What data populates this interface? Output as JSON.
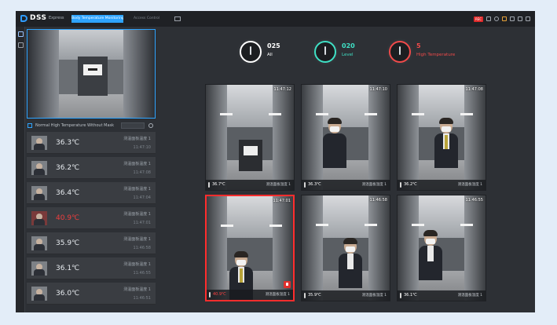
{
  "titlebar": {
    "app_name": "DSS",
    "app_sub": "Express",
    "active_tab": "Body Temperature Monitoring",
    "other_tab": "Access Control",
    "rec_badge": "REC"
  },
  "stats": [
    {
      "value": "025",
      "label": "All",
      "color": "#ffffff"
    },
    {
      "value": "020",
      "label": "Level",
      "color": "#3fe0c5"
    },
    {
      "value": "5",
      "label": "High Temperature",
      "color": "#f04a4a"
    }
  ],
  "filter": {
    "label": "Normal   High Temperature   Without Mask"
  },
  "records": [
    {
      "temp": "36.3℃",
      "name": "测温面板温度 1",
      "time": "11:47:10",
      "alert": false
    },
    {
      "temp": "36.2℃",
      "name": "测温面板温度 1",
      "time": "11:47:08",
      "alert": false
    },
    {
      "temp": "36.4℃",
      "name": "测温面板温度 1",
      "time": "11:47:04",
      "alert": false
    },
    {
      "temp": "40.9℃",
      "name": "测温面板温度 1",
      "time": "11:47:01",
      "alert": true
    },
    {
      "temp": "35.9℃",
      "name": "测温面板温度 1",
      "time": "11:46:58",
      "alert": false
    },
    {
      "temp": "36.1℃",
      "name": "测温面板温度 1",
      "time": "11:46:55",
      "alert": false
    },
    {
      "temp": "36.0℃",
      "name": "测温面板温度 1",
      "time": "11:46:51",
      "alert": false
    }
  ],
  "cameras": [
    {
      "time": "11:47:12",
      "temp": "36.7℃",
      "name": "测温面板温度 1",
      "alert": false
    },
    {
      "time": "11:47:10",
      "temp": "36.3℃",
      "name": "测温面板温度 1",
      "alert": false
    },
    {
      "time": "11:47:08",
      "temp": "36.2℃",
      "name": "测温面板温度 1",
      "alert": false
    },
    {
      "time": "11:47:01",
      "temp": "40.9℃",
      "name": "测温面板温度 1",
      "alert": true
    },
    {
      "time": "11:46:58",
      "temp": "35.9℃",
      "name": "测温面板温度 1",
      "alert": false
    },
    {
      "time": "11:46:55",
      "temp": "36.1℃",
      "name": "测温面板温度 1",
      "alert": false
    }
  ]
}
